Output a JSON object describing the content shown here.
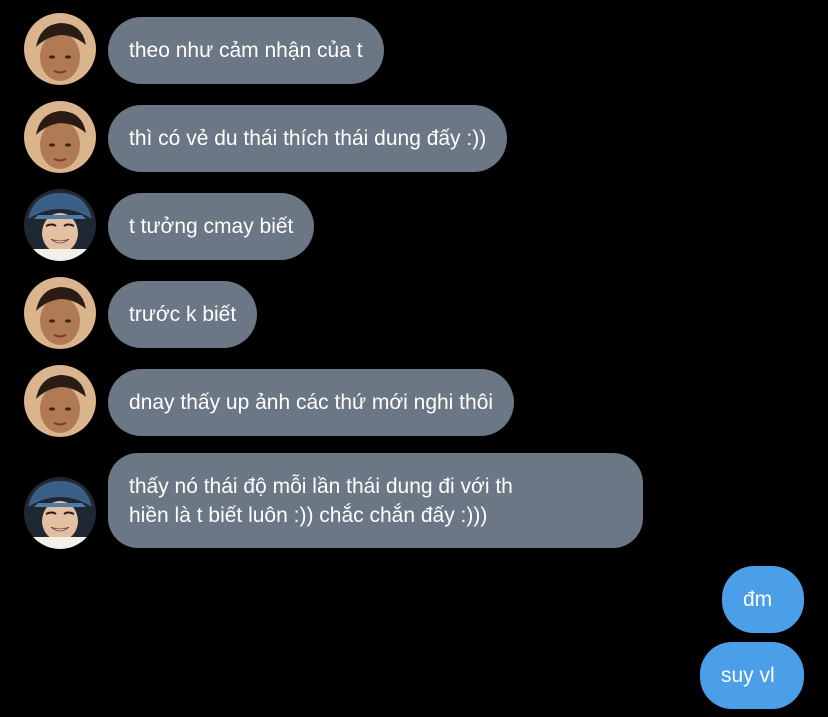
{
  "conversation": {
    "messages": [
      {
        "sender": "friend-a",
        "text": "theo như cảm nhận của t"
      },
      {
        "sender": "friend-a",
        "text": "thì có vẻ du thái thích thái dung đấy :))"
      },
      {
        "sender": "friend-b",
        "text": "t tưởng cmay biết"
      },
      {
        "sender": "friend-a",
        "text": "trước k biết"
      },
      {
        "sender": "friend-a",
        "text": "dnay thấy up ảnh các thứ mới nghi thôi"
      },
      {
        "sender": "friend-b",
        "line1": "thấy nó thái độ mỗi lần thái dung đi với th",
        "line2": "hiền là t biết luôn :)) chắc chắn đấy :)))"
      },
      {
        "sender": "me",
        "text": "đm"
      },
      {
        "sender": "me",
        "text": "suy vl"
      }
    ]
  },
  "colors": {
    "background": "#000000",
    "incoming_bubble": "#6b7785",
    "outgoing_bubble": "#4b9ee8",
    "text": "#ffffff"
  }
}
